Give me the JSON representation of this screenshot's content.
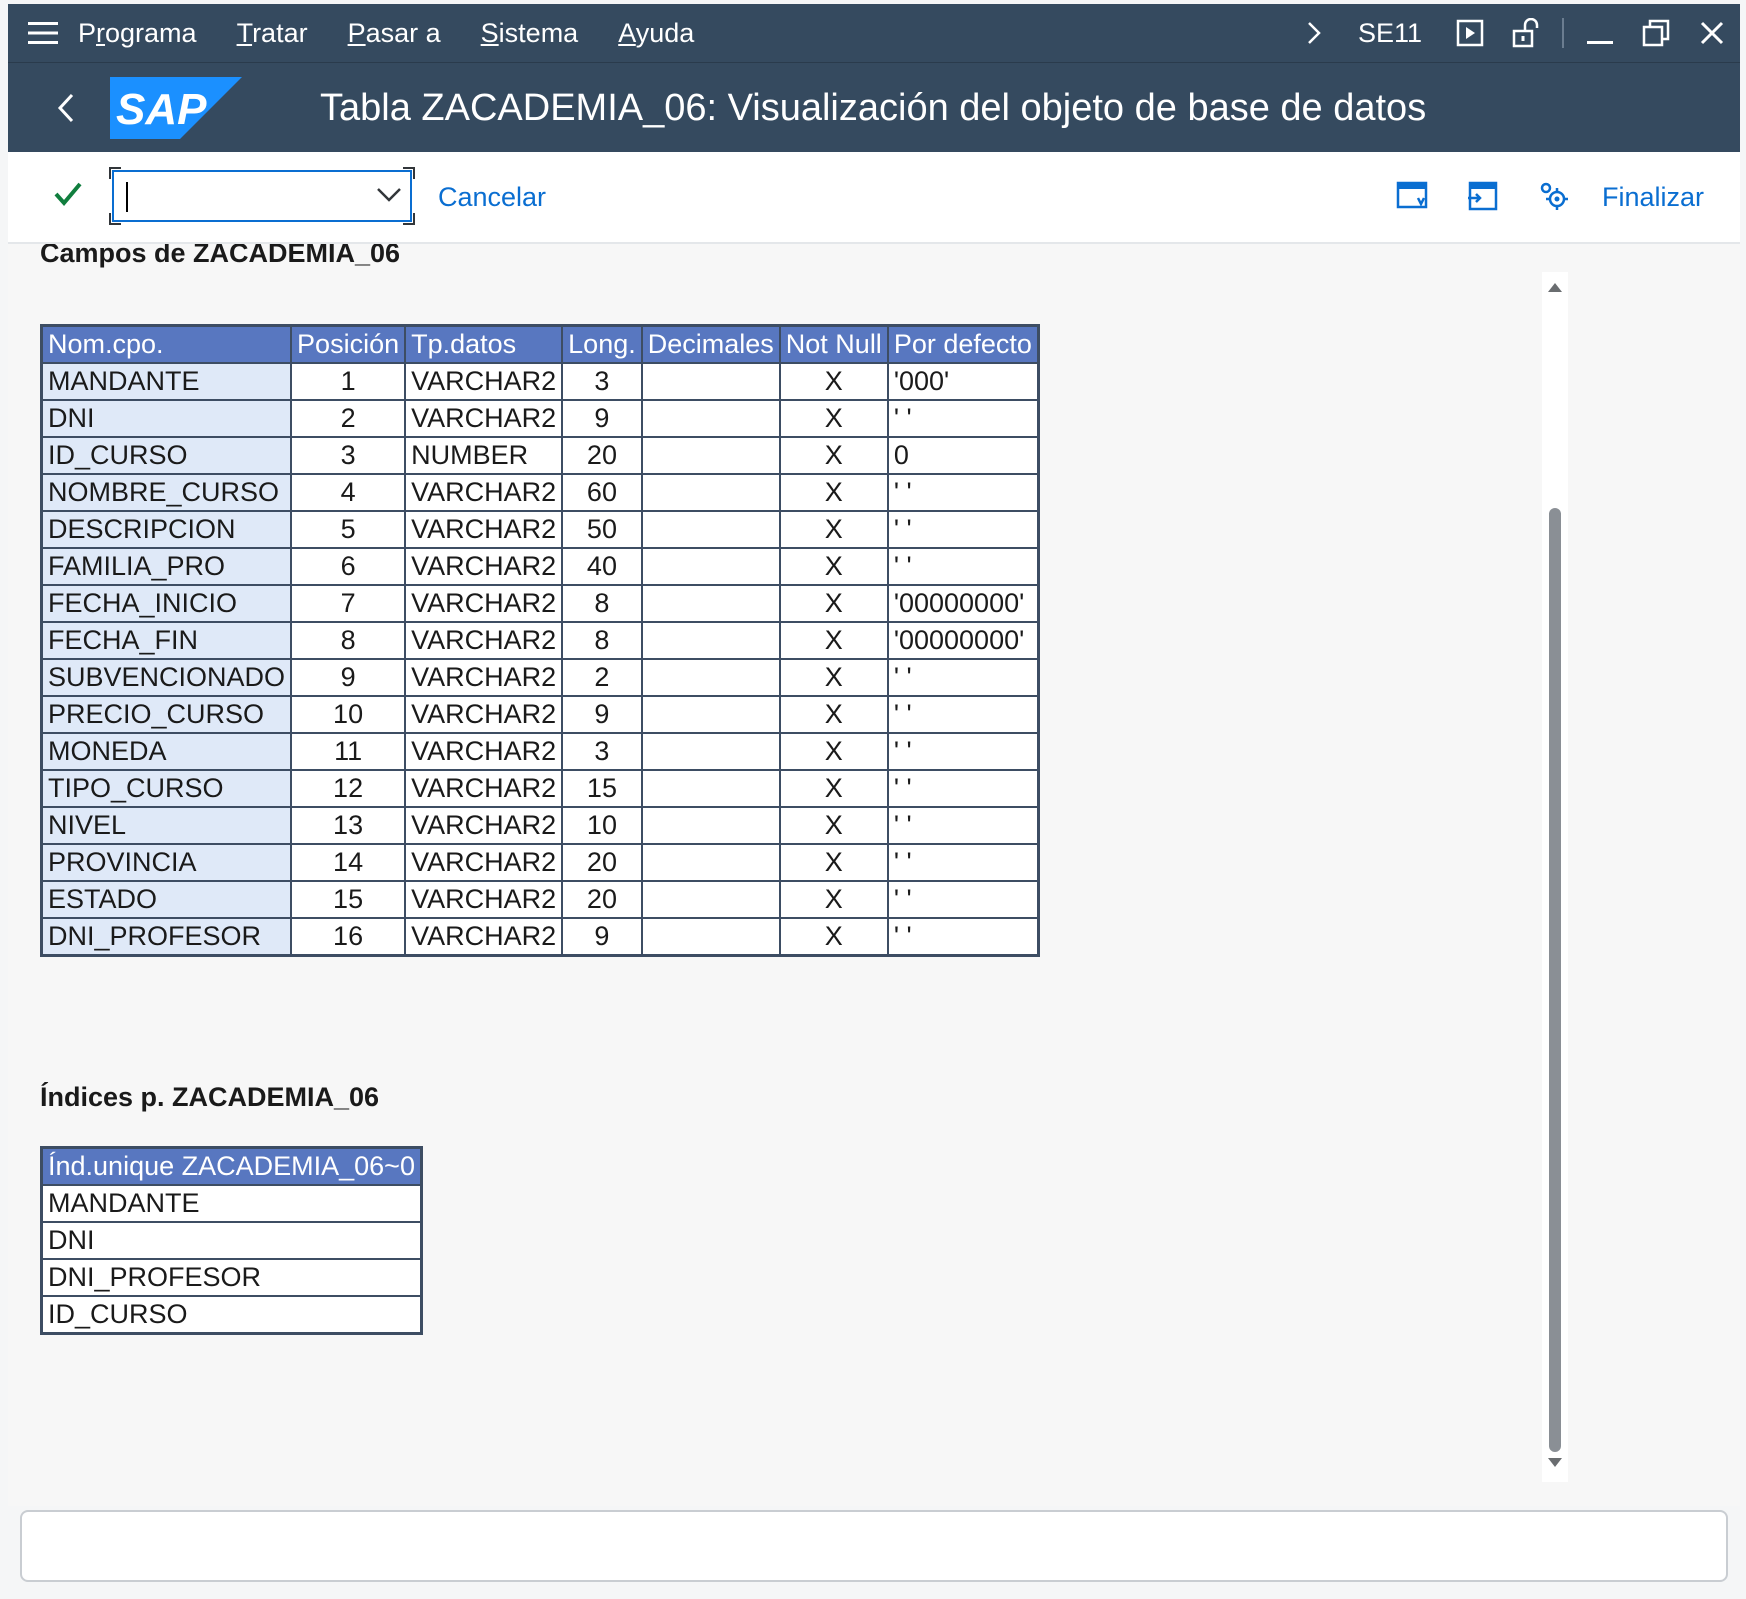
{
  "menubar": {
    "items": [
      {
        "label_pre": "P",
        "label_u": "r",
        "label_post": "ograma"
      },
      {
        "label_pre": "",
        "label_u": "T",
        "label_post": "ratar"
      },
      {
        "label_pre": "",
        "label_u": "P",
        "label_post": "asar a"
      },
      {
        "label_pre": "",
        "label_u": "S",
        "label_post": "istema"
      },
      {
        "label_pre": "",
        "label_u": "A",
        "label_post": "yuda"
      }
    ],
    "transaction": "SE11"
  },
  "header": {
    "logo_text": "SAP",
    "title": "Tabla ZACADEMIA_06: Visualización del objeto de base de datos"
  },
  "toolbar": {
    "command_value": "",
    "cancel_label": "Cancelar",
    "finish_label": "Finalizar"
  },
  "fields_section": {
    "title": "Campos de ZACADEMIA_06",
    "columns": [
      "Nom.cpo.",
      "Posición",
      "Tp.datos",
      "Long.",
      "Decimales",
      "Not Null",
      "Por defecto"
    ],
    "rows": [
      [
        "MANDANTE",
        "1",
        "VARCHAR2",
        "3",
        "",
        "X",
        "'000'"
      ],
      [
        "DNI",
        "2",
        "VARCHAR2",
        "9",
        "",
        "X",
        "' '"
      ],
      [
        "ID_CURSO",
        "3",
        "NUMBER",
        "20",
        "",
        "X",
        "0"
      ],
      [
        "NOMBRE_CURSO",
        "4",
        "VARCHAR2",
        "60",
        "",
        "X",
        "' '"
      ],
      [
        "DESCRIPCION",
        "5",
        "VARCHAR2",
        "50",
        "",
        "X",
        "' '"
      ],
      [
        "FAMILIA_PRO",
        "6",
        "VARCHAR2",
        "40",
        "",
        "X",
        "' '"
      ],
      [
        "FECHA_INICIO",
        "7",
        "VARCHAR2",
        "8",
        "",
        "X",
        "'00000000'"
      ],
      [
        "FECHA_FIN",
        "8",
        "VARCHAR2",
        "8",
        "",
        "X",
        "'00000000'"
      ],
      [
        "SUBVENCIONADO",
        "9",
        "VARCHAR2",
        "2",
        "",
        "X",
        "' '"
      ],
      [
        "PRECIO_CURSO",
        "10",
        "VARCHAR2",
        "9",
        "",
        "X",
        "' '"
      ],
      [
        "MONEDA",
        "11",
        "VARCHAR2",
        "3",
        "",
        "X",
        "' '"
      ],
      [
        "TIPO_CURSO",
        "12",
        "VARCHAR2",
        "15",
        "",
        "X",
        "' '"
      ],
      [
        "NIVEL",
        "13",
        "VARCHAR2",
        "10",
        "",
        "X",
        "' '"
      ],
      [
        "PROVINCIA",
        "14",
        "VARCHAR2",
        "20",
        "",
        "X",
        "' '"
      ],
      [
        "ESTADO",
        "15",
        "VARCHAR2",
        "20",
        "",
        "X",
        "' '"
      ],
      [
        "DNI_PROFESOR",
        "16",
        "VARCHAR2",
        "9",
        "",
        "X",
        "' '"
      ]
    ]
  },
  "indices_section": {
    "title": "Índices p. ZACADEMIA_06",
    "header": "Índ.unique ZACADEMIA_06~0",
    "rows": [
      "MANDANTE",
      "DNI",
      "DNI_PROFESOR",
      "ID_CURSO"
    ]
  },
  "colors": {
    "shell": "#354a5f",
    "table_header": "#5877c0",
    "name_cell": "#dfe9f8",
    "link": "#0a6ed1",
    "check": "#107e3e"
  },
  "icons": [
    "hamburger-icon",
    "chevron-right-icon",
    "play-icon",
    "unlock-icon",
    "minimize-icon",
    "restore-icon",
    "close-icon",
    "back-icon",
    "check-icon",
    "dropdown-icon",
    "new-window-icon",
    "generate-icon",
    "settings-icon",
    "scroll-up-icon",
    "scroll-down-icon"
  ]
}
